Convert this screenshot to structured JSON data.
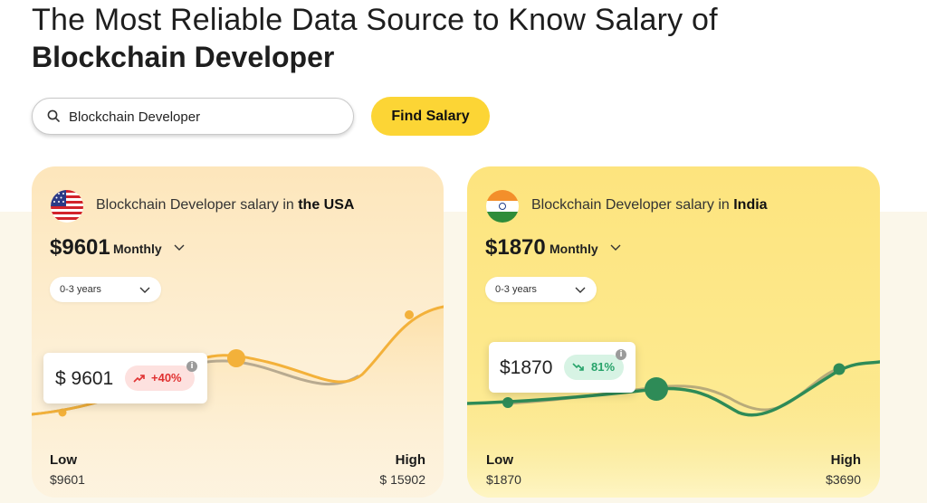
{
  "headline": {
    "line1": "The Most Reliable Data Source to Know Salary of",
    "line2": "Blockchain Developer"
  },
  "search": {
    "value": "Blockchain Developer",
    "button_label": "Find Salary"
  },
  "cards": [
    {
      "title_prefix": "Blockchain Developer salary in ",
      "country": "the USA",
      "flag": "usa-flag-icon",
      "amount": "$9601",
      "period": "Monthly",
      "experience": "0-3 years",
      "tooltip_value": "$ 9601",
      "tooltip_change": "+40%",
      "tooltip_change_color": "#e03131",
      "low_label": "Low",
      "low_value": "$9601",
      "high_label": "High",
      "high_value": "$ 15902",
      "accent": "#f3b13a"
    },
    {
      "title_prefix": "Blockchain Developer salary in ",
      "country": "India",
      "flag": "india-flag-icon",
      "amount": "$1870",
      "period": "Monthly",
      "experience": "0-3 years",
      "tooltip_value": "$1870",
      "tooltip_change": "81%",
      "tooltip_change_color": "#27a36a",
      "low_label": "Low",
      "low_value": "$1870",
      "high_label": "High",
      "high_value": "$3690",
      "accent": "#2e8b57"
    }
  ]
}
